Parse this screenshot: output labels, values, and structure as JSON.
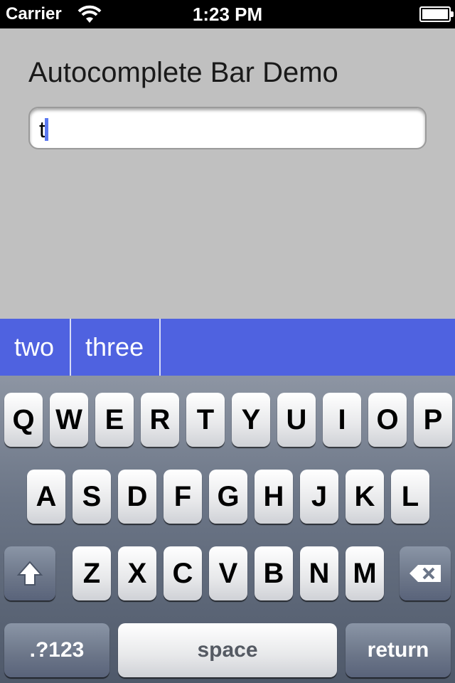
{
  "status_bar": {
    "carrier": "Carrier",
    "time": "1:23 PM",
    "battery_level": 1.0
  },
  "app": {
    "title": "Autocomplete Bar Demo",
    "text_field": {
      "value": "t"
    }
  },
  "autocomplete": {
    "suggestions": [
      "two",
      "three"
    ]
  },
  "keyboard": {
    "row1": [
      "Q",
      "W",
      "E",
      "R",
      "T",
      "Y",
      "U",
      "I",
      "O",
      "P"
    ],
    "row2": [
      "A",
      "S",
      "D",
      "F",
      "G",
      "H",
      "J",
      "K",
      "L"
    ],
    "row3": [
      "Z",
      "X",
      "C",
      "V",
      "B",
      "N",
      "M"
    ],
    "numbers_label": ".?123",
    "space_label": "space",
    "return_label": "return",
    "icons": {
      "shift": "shift-icon",
      "delete": "backspace-icon"
    }
  },
  "colors": {
    "accent": "#4f62e0",
    "background": "#c0c0c0",
    "caret": "#5b78f0"
  }
}
